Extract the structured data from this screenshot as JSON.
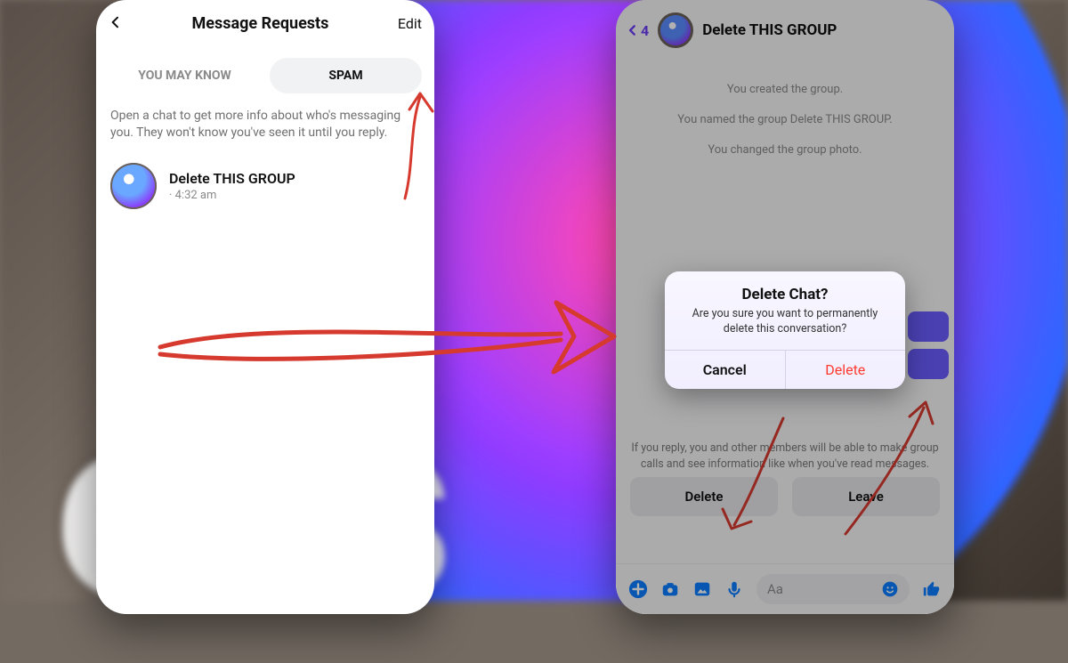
{
  "left": {
    "nav_title": "Message Requests",
    "edit_label": "Edit",
    "tabs": {
      "you_may_know": "YOU MAY KNOW",
      "spam": "SPAM"
    },
    "info": "Open a chat to get more info about who's messaging you. They won't know you've seen it until you reply.",
    "conversation": {
      "title": "Delete THIS GROUP",
      "subtitle": "· 4:32 am"
    }
  },
  "right": {
    "back_count": "4",
    "title": "Delete THIS GROUP",
    "system_lines": {
      "l1": "You created the group.",
      "l2": "You named the group Delete THIS GROUP.",
      "l3": "You changed the group photo."
    },
    "reply_note": "If you reply, you and other members will be able to make group calls and see information like when you've read messages.",
    "actions": {
      "delete": "Delete",
      "leave": "Leave"
    },
    "composer_placeholder": "Aa",
    "peek_labels": {
      "one": "at",
      "two": "le"
    }
  },
  "alert": {
    "title": "Delete Chat?",
    "body": "Are you sure you want to permanently delete this conversation?",
    "cancel": "Cancel",
    "delete": "Delete"
  }
}
